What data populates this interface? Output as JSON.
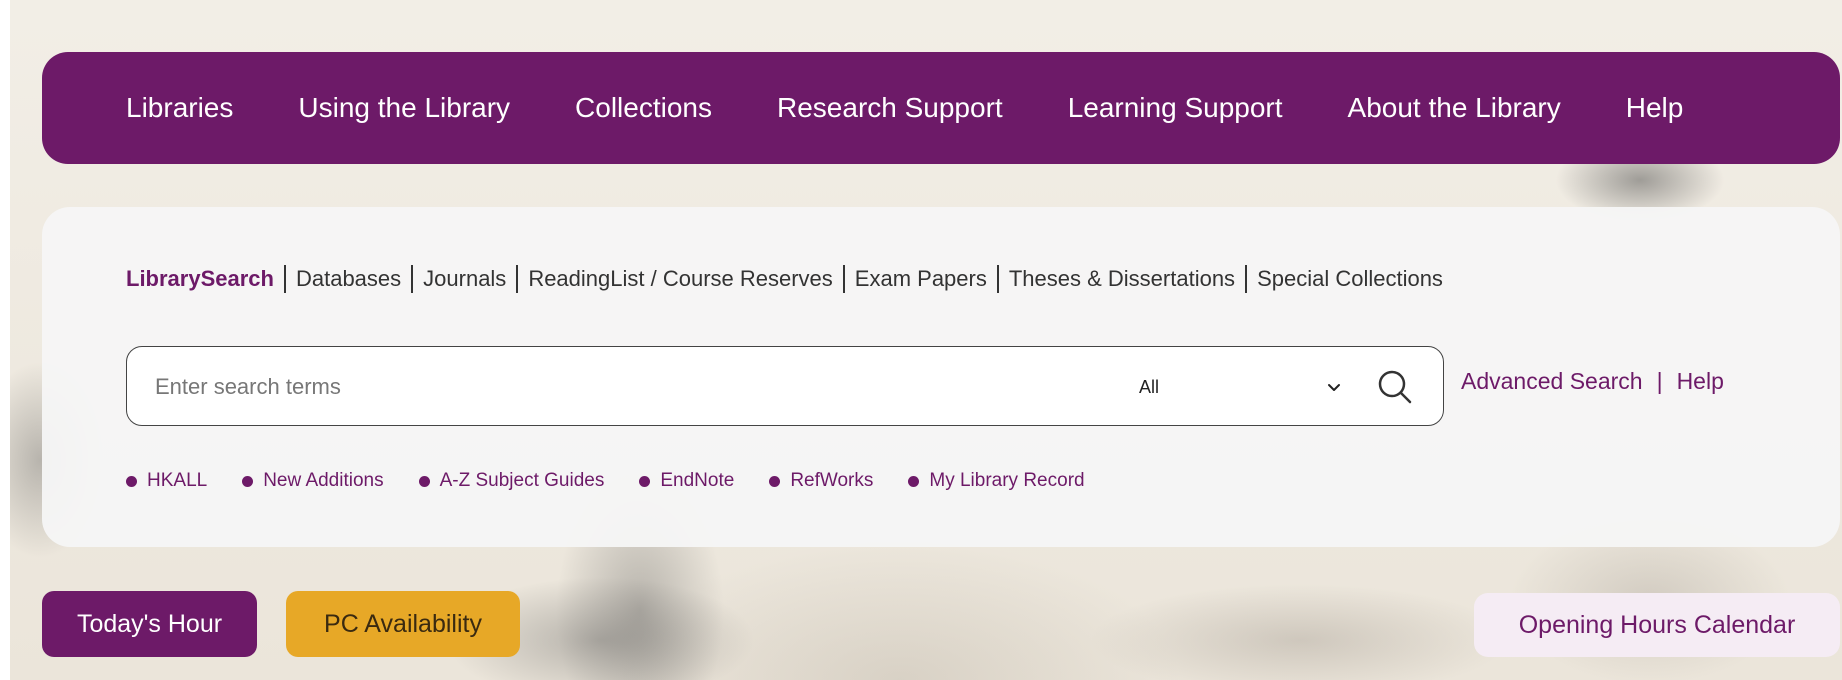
{
  "top_nav": {
    "items": [
      {
        "label": "Libraries"
      },
      {
        "label": "Using the Library"
      },
      {
        "label": "Collections"
      },
      {
        "label": "Research Support"
      },
      {
        "label": "Learning Support"
      },
      {
        "label": "About the Library"
      },
      {
        "label": "Help"
      }
    ]
  },
  "search_tabs": {
    "items": [
      {
        "label": "LibrarySearch",
        "active": true
      },
      {
        "label": "Databases"
      },
      {
        "label": "Journals"
      },
      {
        "label": "ReadingList / Course Reserves"
      },
      {
        "label": "Exam Papers"
      },
      {
        "label": "Theses & Dissertations"
      },
      {
        "label": "Special Collections"
      }
    ]
  },
  "search": {
    "placeholder": "Enter search terms",
    "value": "",
    "scope_selected": "All",
    "scope_icon": "chevron-down-icon",
    "button_icon": "search-icon"
  },
  "search_links": {
    "advanced": "Advanced Search",
    "separator": "|",
    "help": "Help"
  },
  "quick_links": {
    "items": [
      {
        "label": "HKALL"
      },
      {
        "label": "New Additions"
      },
      {
        "label": "A-Z Subject Guides"
      },
      {
        "label": "EndNote"
      },
      {
        "label": "RefWorks"
      },
      {
        "label": "My Library Record"
      }
    ]
  },
  "bottom": {
    "todays_hour": "Today's Hour",
    "pc_availability": "PC Availability",
    "opening_hours_calendar": "Opening Hours Calendar"
  },
  "colors": {
    "brand_purple": "#6d1a68",
    "accent_gold": "#e7a827",
    "panel_bg": "#f6f6f6"
  }
}
